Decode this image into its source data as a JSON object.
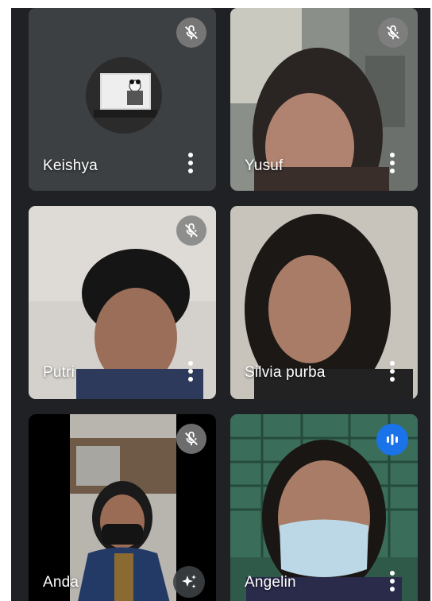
{
  "participants": [
    {
      "name": "Keishya",
      "mic": "muted",
      "video": "off"
    },
    {
      "name": "Yusuf",
      "mic": "muted",
      "video": "on"
    },
    {
      "name": "Putri",
      "mic": "muted",
      "video": "on"
    },
    {
      "name": "Silvia purba",
      "mic": "on",
      "video": "on"
    },
    {
      "name": "Anda",
      "mic": "muted",
      "video": "on"
    },
    {
      "name": "Angelin",
      "mic": "speaking",
      "video": "on"
    }
  ],
  "icons": {
    "mute": "mic-off-icon",
    "speaking": "audio-level-icon",
    "more": "more-vert-icon",
    "effects": "sparkle-icon"
  },
  "colors": {
    "background": "#202124",
    "tile": "#3c4043",
    "speaking_indicator": "#1a73e8",
    "muted_indicator": "#808080"
  }
}
